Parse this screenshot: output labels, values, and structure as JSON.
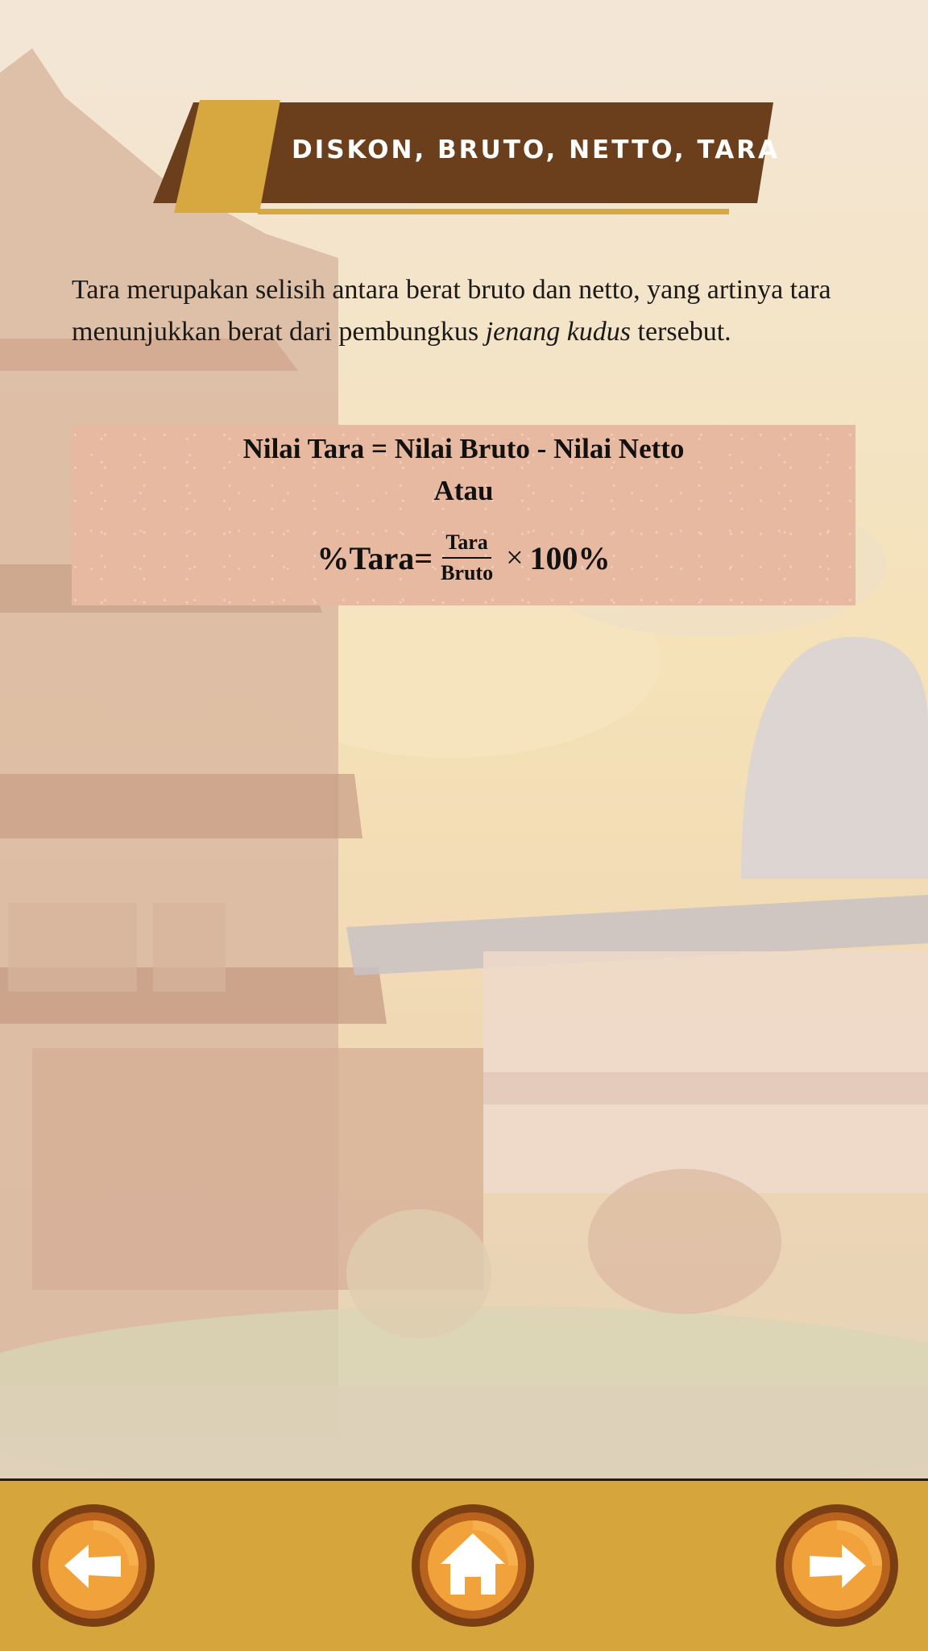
{
  "header": {
    "title": "DISKON, BRUTO, NETTO, TARA"
  },
  "content": {
    "paragraph_start": "Tara merupakan selisih antara berat bruto dan netto, yang artinya tara menunjukkan berat dari pembungkus ",
    "paragraph_italic": "jenang kudus",
    "paragraph_end": " tersebut."
  },
  "formula": {
    "line1": "Nilai Tara = Nilai Bruto - Nilai Netto",
    "line2": "Atau",
    "lhs": "%Tara=",
    "numerator": "Tara",
    "denominator": "Bruto",
    "times": "×",
    "rhs": "100%"
  },
  "nav": {
    "prev_icon": "arrow-left-icon",
    "home_icon": "home-icon",
    "next_icon": "arrow-right-icon"
  },
  "colors": {
    "banner_brown": "#6b3f1c",
    "banner_gold": "#d8a840",
    "formula_bg": "#e6b9a0",
    "bottom_bar": "#d6a63d",
    "button_orange": "#f2a23a"
  }
}
